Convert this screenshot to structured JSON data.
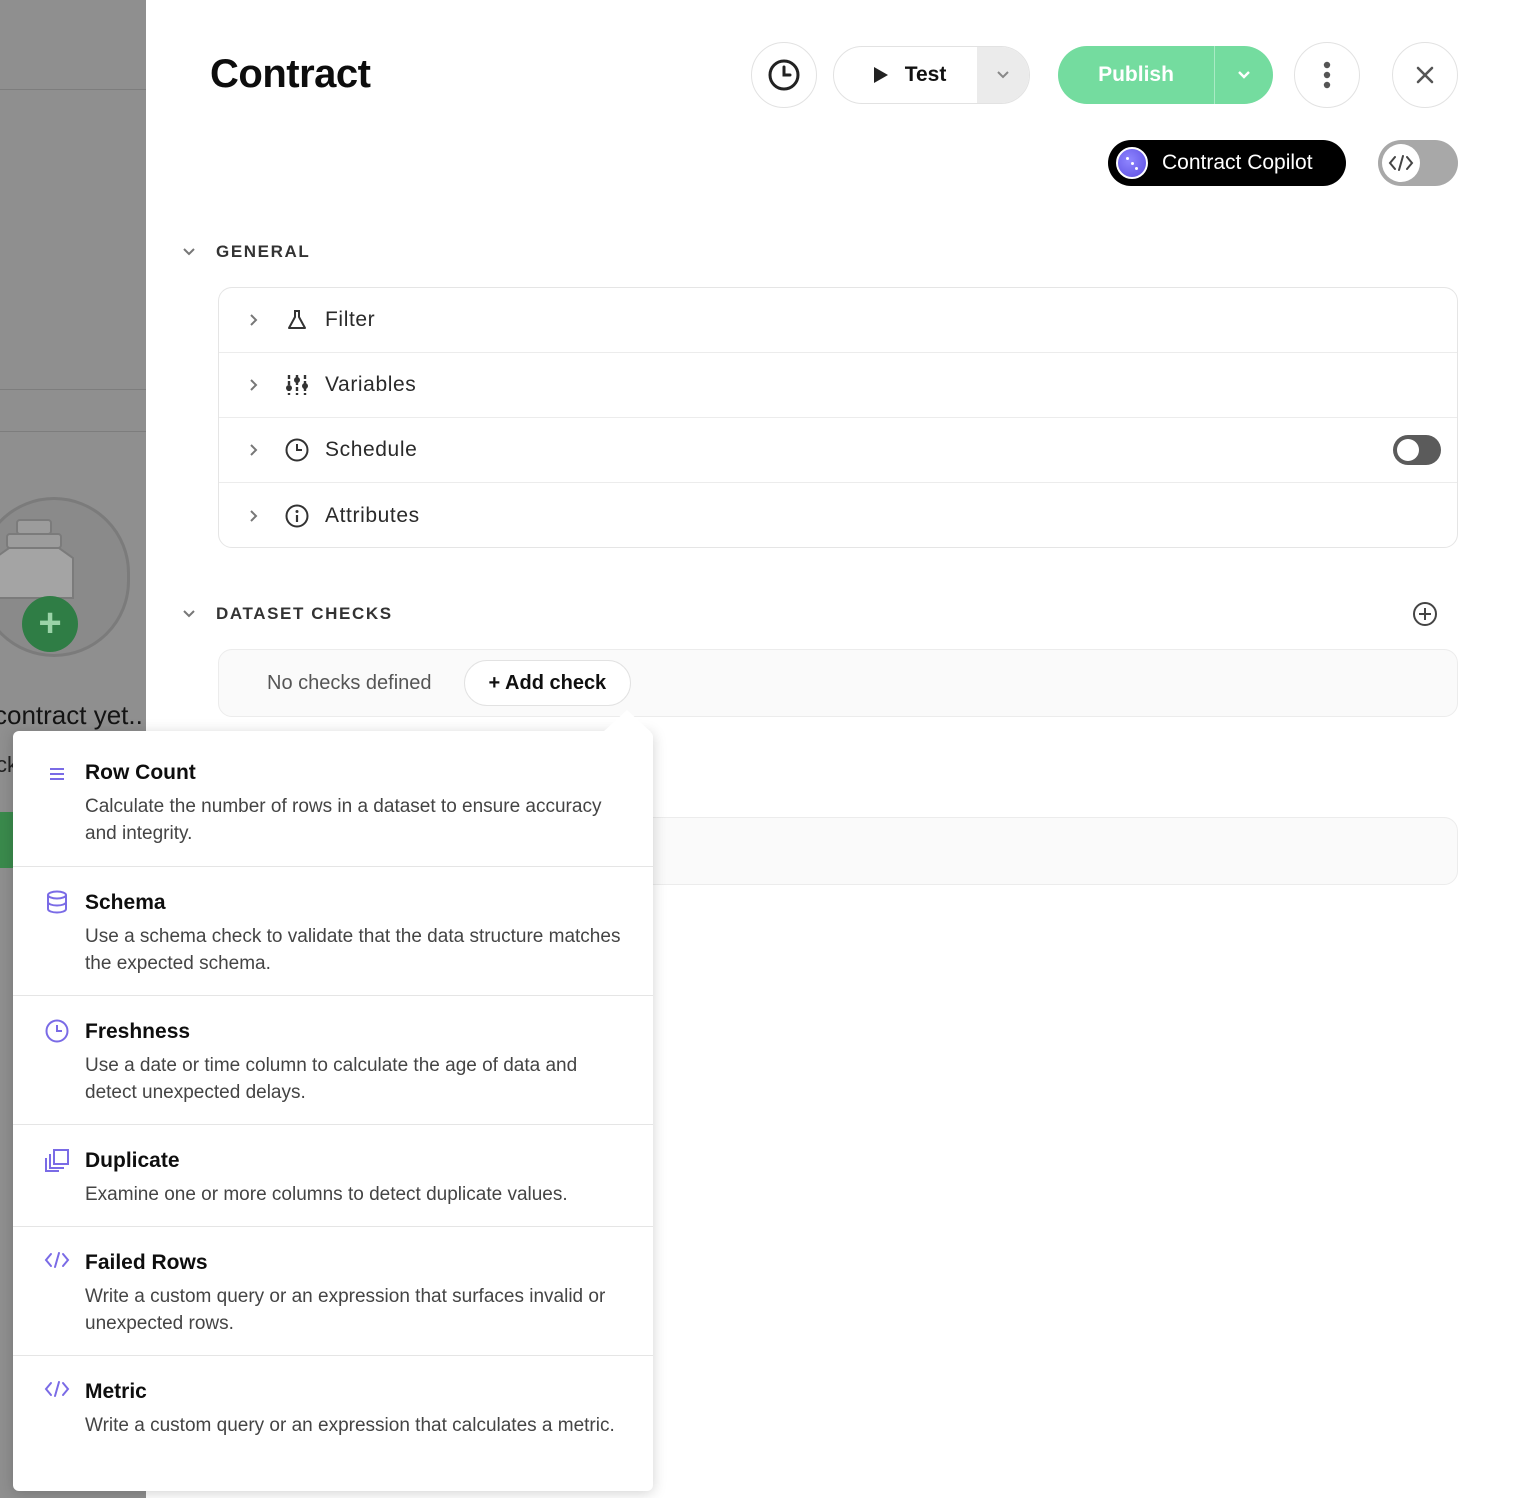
{
  "background": {
    "visible_text_1": "contract yet..",
    "visible_text_2": "ck"
  },
  "header": {
    "title": "Contract",
    "test_label": "Test",
    "publish_label": "Publish",
    "copilot_label": "Contract Copilot"
  },
  "general": {
    "heading": "GENERAL",
    "rows": [
      {
        "label": "Filter",
        "icon": "flask-icon"
      },
      {
        "label": "Variables",
        "icon": "sliders-icon"
      },
      {
        "label": "Schedule",
        "icon": "clock-icon",
        "toggle_on": false
      },
      {
        "label": "Attributes",
        "icon": "info-icon"
      }
    ]
  },
  "dataset_checks": {
    "heading": "DATASET CHECKS",
    "empty_text": "No checks defined",
    "add_label": "+ Add check"
  },
  "check_menu": {
    "items": [
      {
        "title": "Row Count",
        "icon": "lines-icon",
        "description": "Calculate the number of rows in a dataset to ensure accuracy and integrity."
      },
      {
        "title": "Schema",
        "icon": "database-icon",
        "description": "Use a schema check to validate that the data structure matches the expected schema."
      },
      {
        "title": "Freshness",
        "icon": "clock-icon",
        "description": "Use a date or time column to calculate the age of data and detect unexpected delays."
      },
      {
        "title": "Duplicate",
        "icon": "copy-icon",
        "description": "Examine one or more columns to detect duplicate values."
      },
      {
        "title": "Failed Rows",
        "icon": "code-icon",
        "description": "Write a custom query or an expression that surfaces invalid or unexpected rows."
      },
      {
        "title": "Metric",
        "icon": "code-icon",
        "description": "Write a custom query or an expression that calculates a metric."
      }
    ]
  },
  "colors": {
    "publish": "#74dc9f",
    "accent_icon": "#7a6be6",
    "copilot_bg": "#000000"
  }
}
